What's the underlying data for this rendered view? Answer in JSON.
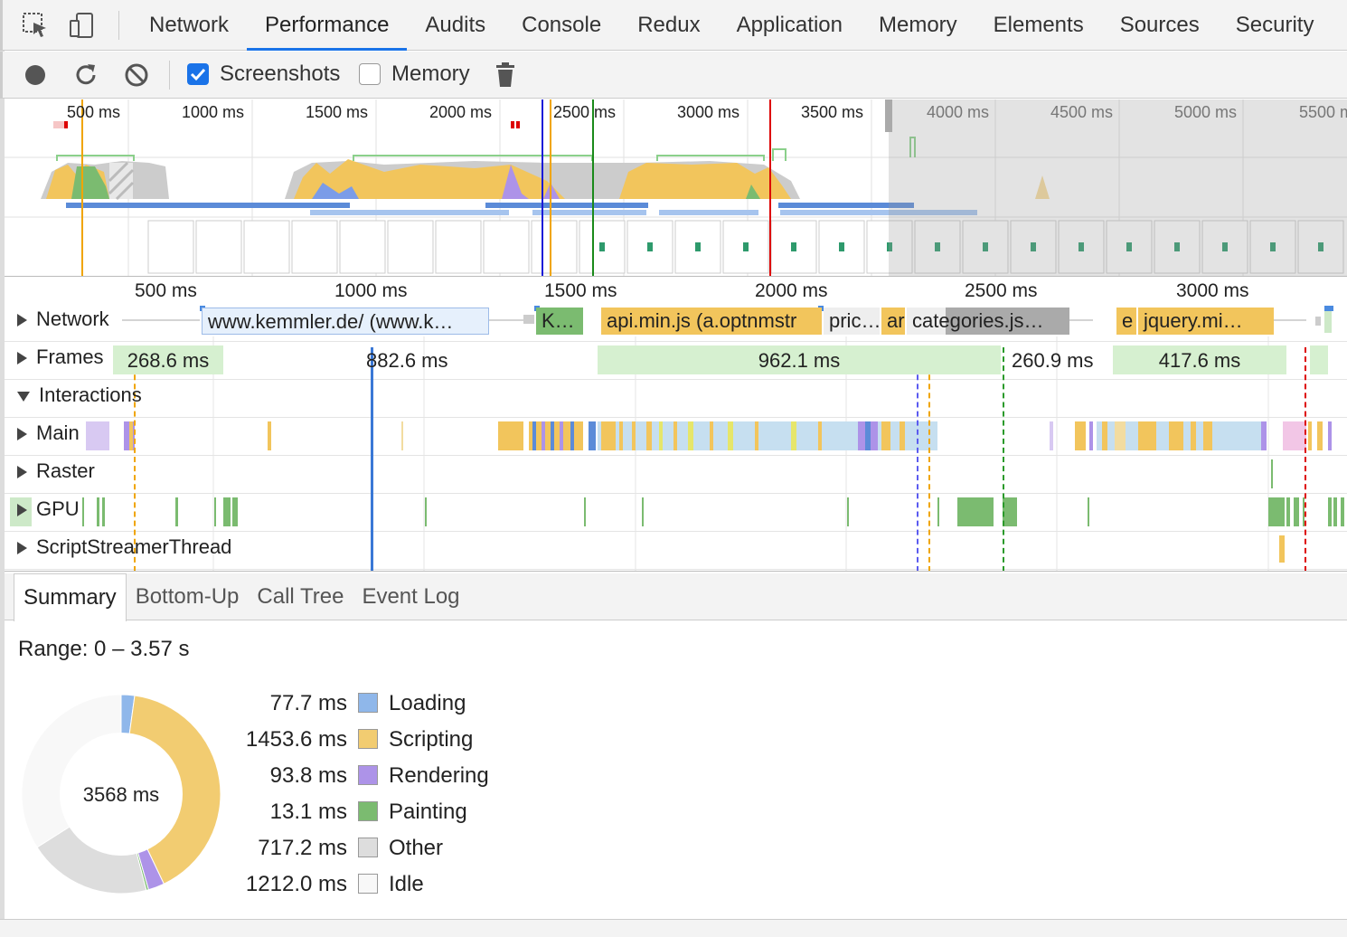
{
  "tabs": [
    "Network",
    "Performance",
    "Audits",
    "Console",
    "Redux",
    "Application",
    "Memory",
    "Elements",
    "Sources",
    "Security"
  ],
  "active_tab": "Performance",
  "toolbar": {
    "screenshots_label": "Screenshots",
    "screenshots_checked": true,
    "memory_label": "Memory",
    "memory_checked": false
  },
  "overview_ticks": [
    "500 ms",
    "1000 ms",
    "1500 ms",
    "2000 ms",
    "2500 ms",
    "3000 ms",
    "3500 ms",
    "4000 ms",
    "4500 ms",
    "5000 ms",
    "5500 ms"
  ],
  "ruler_ticks": [
    "500 ms",
    "1000 ms",
    "1500 ms",
    "2000 ms",
    "2500 ms",
    "3000 ms"
  ],
  "tracks": {
    "network": "Network",
    "frames": "Frames",
    "interactions": "Interactions",
    "main": "Main",
    "raster": "Raster",
    "gpu": "GPU",
    "script_streamer": "ScriptStreamerThread"
  },
  "network_items": [
    "www.kemmler.de/ (www.k…",
    "K…",
    "api.min.js (a.optnmstr",
    "pric…",
    "ar",
    "categories.js…",
    "e",
    "jquery.mi…"
  ],
  "frames": [
    "268.6 ms",
    "882.6 ms",
    "962.1 ms",
    "260.9 ms",
    "417.6 ms"
  ],
  "subtabs": [
    "Summary",
    "Bottom-Up",
    "Call Tree",
    "Event Log"
  ],
  "active_subtab": "Summary",
  "summary": {
    "range": "Range: 0 – 3.57 s",
    "total": "3568 ms",
    "legend": [
      {
        "value": "77.7 ms",
        "name": "Loading",
        "color": "#8fb7ea",
        "ms": 77.7
      },
      {
        "value": "1453.6 ms",
        "name": "Scripting",
        "color": "#f2cc71",
        "ms": 1453.6
      },
      {
        "value": "93.8 ms",
        "name": "Rendering",
        "color": "#ad93e8",
        "ms": 93.8
      },
      {
        "value": "13.1 ms",
        "name": "Painting",
        "color": "#7bbb70",
        "ms": 13.1
      },
      {
        "value": "717.2 ms",
        "name": "Other",
        "color": "#dddddd",
        "ms": 717.2
      },
      {
        "value": "1212.0 ms",
        "name": "Idle",
        "color": "#f8f8f8",
        "ms": 1212.0
      }
    ]
  }
}
